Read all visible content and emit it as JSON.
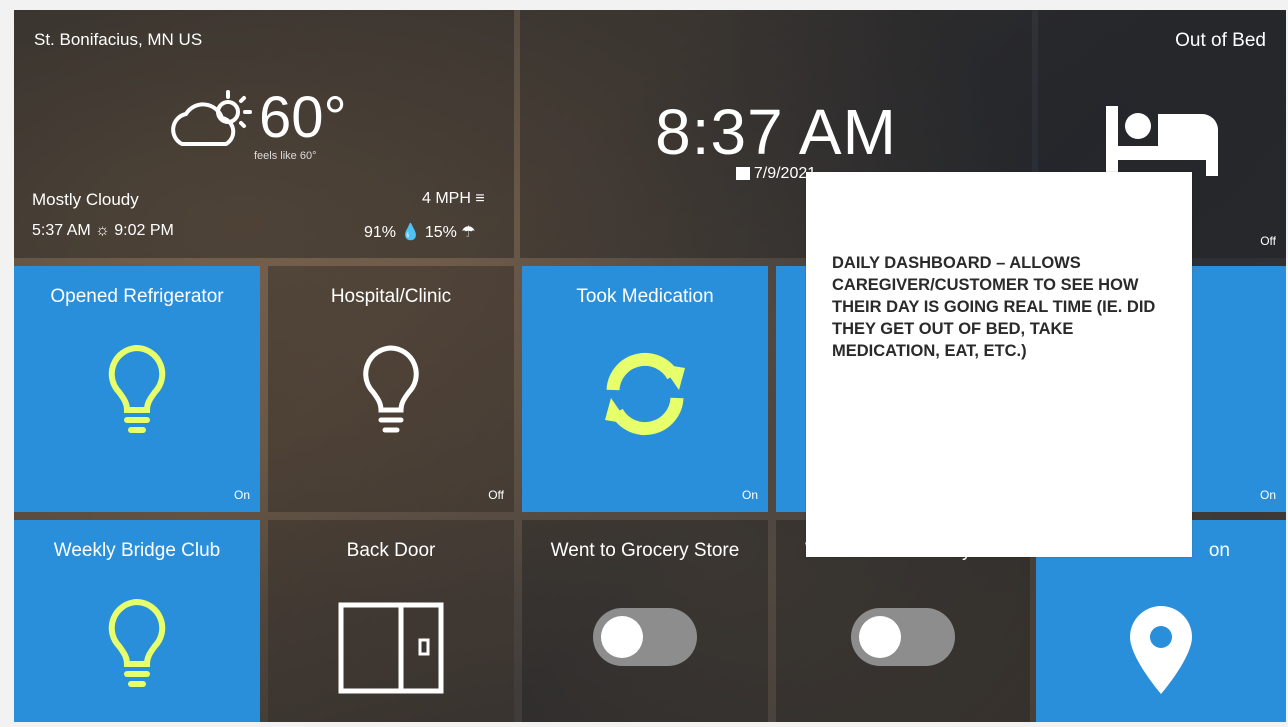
{
  "weather": {
    "location": "St. Bonifacius, MN US",
    "temperature": "60°",
    "feels_like": "feels like 60°",
    "condition": "Mostly Cloudy",
    "sunrise_sunset": "5:37 AM ☼ 9:02 PM",
    "wind": "4 MPH",
    "humidity_precip": "91% 💧 15% ☂"
  },
  "clock": {
    "time": "8:37 AM",
    "date": "7/9/2021"
  },
  "tiles": {
    "out_of_bed": {
      "label": "Out of Bed",
      "state": "Off"
    },
    "opened_refrigerator": {
      "label": "Opened Refrigerator",
      "state": "On"
    },
    "hospital_clinic": {
      "label": "Hospital/Clinic",
      "state": "Off"
    },
    "took_medication": {
      "label": "Took Medication",
      "state": "On"
    },
    "row2_col4": {
      "state": "On"
    },
    "weekly_bridge_club": {
      "label": "Weekly Bridge Club"
    },
    "back_door": {
      "label": "Back Door"
    },
    "went_grocery": {
      "label": "Went to Grocery Store"
    },
    "went_community": {
      "label": "Went to Community Ce"
    },
    "location": {
      "label": "on"
    }
  },
  "note": {
    "text": "DAILY DASHBOARD – ALLOWS CAREGIVER/CUSTOMER TO SEE HOW THEIR DAY IS GOING REAL TIME (IE. DID THEY GET OUT OF BED, TAKE MEDICATION, EAT, ETC.)"
  },
  "colors": {
    "tile_blue": "#2a8fdb",
    "bulb_glow": "#e6ff6a"
  }
}
